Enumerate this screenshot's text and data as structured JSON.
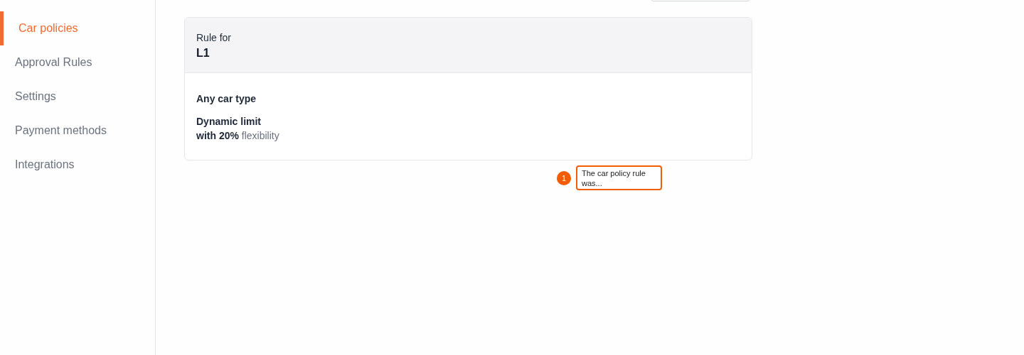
{
  "sidebar": {
    "items": [
      {
        "label": "Car policies",
        "selected": true
      },
      {
        "label": "Approval Rules",
        "selected": false
      },
      {
        "label": "Settings",
        "selected": false
      },
      {
        "label": "Payment methods",
        "selected": false
      },
      {
        "label": "Integrations",
        "selected": false
      }
    ]
  },
  "rule_card": {
    "header_label": "Rule for",
    "header_value": "L1",
    "car_type": "Any car type",
    "limit_title": "Dynamic limit",
    "limit_detail": "**with 20%** flexibility"
  },
  "annotation": {
    "number": "1",
    "text": "The car policy rule was..."
  }
}
